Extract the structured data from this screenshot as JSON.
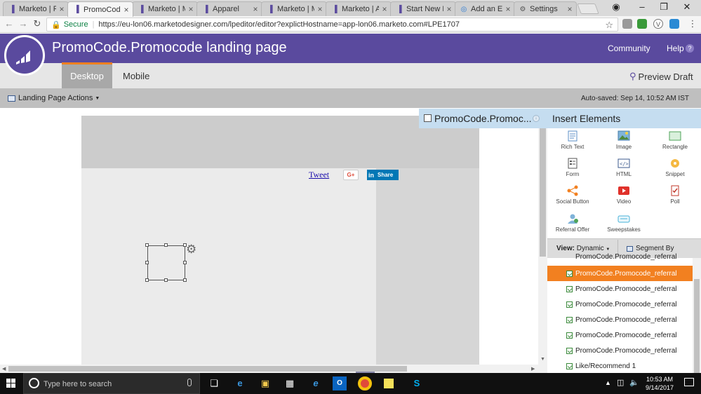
{
  "browser": {
    "tabs": [
      {
        "label": "Marketo | P",
        "favicon": "marketo-icon",
        "active": false
      },
      {
        "label": "PromoCode",
        "favicon": "marketo-icon",
        "active": true
      },
      {
        "label": "Marketo | M",
        "favicon": "marketo-icon",
        "active": false
      },
      {
        "label": "Apparel",
        "favicon": "marketo-icon",
        "active": false
      },
      {
        "label": "Marketo | M",
        "favicon": "marketo-icon",
        "active": false
      },
      {
        "label": "Marketo | A",
        "favicon": "marketo-icon",
        "active": false
      },
      {
        "label": "Start New D",
        "favicon": "marketo-icon",
        "active": false
      },
      {
        "label": "Add an Exis",
        "favicon": "globe-icon",
        "active": false
      },
      {
        "label": "Settings",
        "favicon": "gear-icon",
        "active": false
      }
    ],
    "secure_label": "Secure",
    "url": "https://eu-lon06.marketodesigner.com/lpeditor/editor?explictHostname=app-lon06.marketo.com#LPE1707"
  },
  "app": {
    "title": "PromoCode.Promocode landing page",
    "community": "Community",
    "help": "Help",
    "help_icon": "?",
    "tabs": {
      "desktop": "Desktop",
      "mobile": "Mobile"
    },
    "preview": "Preview Draft",
    "actions": "Landing Page Actions",
    "autosaved": "Auto-saved: Sep 14, 10:52 AM IST",
    "brand_color": "#5a4a9e",
    "accent_color": "#f28020"
  },
  "canvas": {
    "tweet": "Tweet",
    "gplus": "G+",
    "linkedin_in": "in",
    "linkedin_share": "Share"
  },
  "page_panel": {
    "label": "PromoCode.Promoc..."
  },
  "insert": {
    "title": "Insert Elements",
    "elements": [
      {
        "label": "Rich Text",
        "icon": "rich-text-icon"
      },
      {
        "label": "Image",
        "icon": "image-icon"
      },
      {
        "label": "Rectangle",
        "icon": "rectangle-icon"
      },
      {
        "label": "Form",
        "icon": "form-icon"
      },
      {
        "label": "HTML",
        "icon": "html-icon"
      },
      {
        "label": "Snippet",
        "icon": "snippet-icon"
      },
      {
        "label": "Social Button",
        "icon": "share-icon"
      },
      {
        "label": "Video",
        "icon": "video-icon"
      },
      {
        "label": "Poll",
        "icon": "poll-icon"
      },
      {
        "label": "Referral Offer",
        "icon": "referral-icon"
      },
      {
        "label": "Sweepstakes",
        "icon": "sweepstakes-icon"
      }
    ]
  },
  "view": {
    "label": "View:",
    "value": "Dynamic",
    "segment": "Segment By"
  },
  "tree": {
    "partial_top": "PromoCode.Promocode_referral",
    "items": [
      {
        "label": "PromoCode.Promocode_referral",
        "selected": true
      },
      {
        "label": "PromoCode.Promocode_referral",
        "selected": false
      },
      {
        "label": "PromoCode.Promocode_referral",
        "selected": false
      },
      {
        "label": "PromoCode.Promocode_referral",
        "selected": false
      },
      {
        "label": "PromoCode.Promocode_referral",
        "selected": false
      },
      {
        "label": "PromoCode.Promocode_referral",
        "selected": false
      },
      {
        "label": "Like/Recommend 1",
        "selected": false
      }
    ]
  },
  "taskbar": {
    "search_placeholder": "Type here to search",
    "time": "10:53 AM",
    "date": "9/14/2017"
  }
}
